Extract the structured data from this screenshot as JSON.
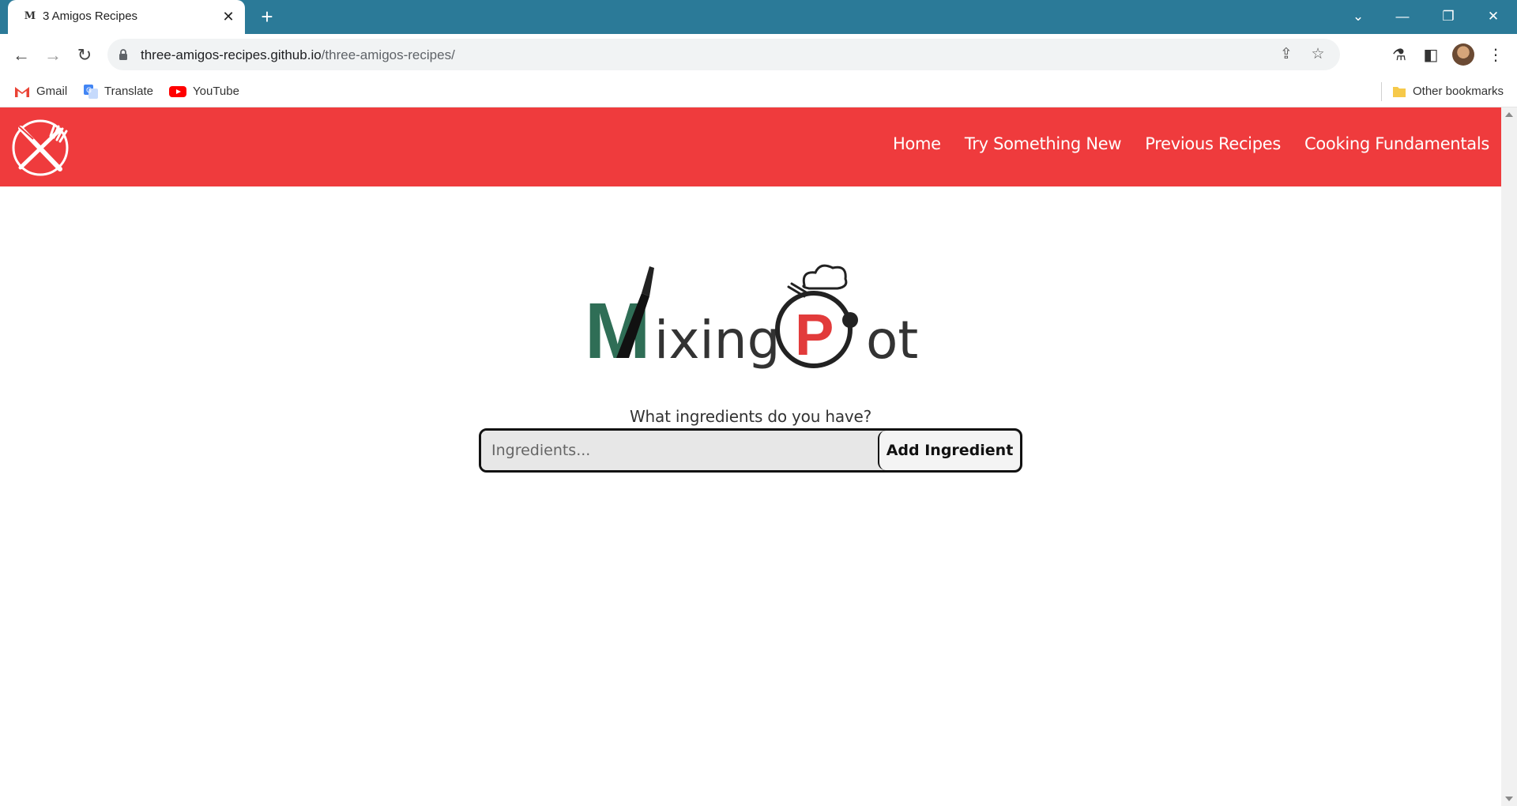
{
  "browser": {
    "tab": {
      "title": "3 Amigos Recipes",
      "favicon_glyph": "M"
    },
    "new_tab": "+",
    "url": {
      "host": "three-amigos-recipes.github.io",
      "path": "/three-amigos-recipes/"
    },
    "bookmarks": [
      {
        "label": "Gmail",
        "icon": "gmail-icon"
      },
      {
        "label": "Translate",
        "icon": "translate-icon"
      },
      {
        "label": "YouTube",
        "icon": "youtube-icon"
      }
    ],
    "other_bookmarks": "Other bookmarks",
    "colors": {
      "tabbar": "#2b7a98",
      "omnibox": "#f1f3f4"
    }
  },
  "site": {
    "nav": [
      "Home",
      "Try Something New",
      "Previous Recipes",
      "Cooking Fundamentals"
    ],
    "brand": {
      "word1": "ixing",
      "word2": "ot",
      "letter_m": "M",
      "letter_p": "P"
    },
    "prompt": "What ingredients do you have?",
    "search": {
      "placeholder": "Ingredients...",
      "value": ""
    },
    "add_button": "Add Ingredient",
    "colors": {
      "header": "#ef3b3d",
      "brand_green": "#2f6e56",
      "brand_red": "#e23b3b"
    }
  }
}
